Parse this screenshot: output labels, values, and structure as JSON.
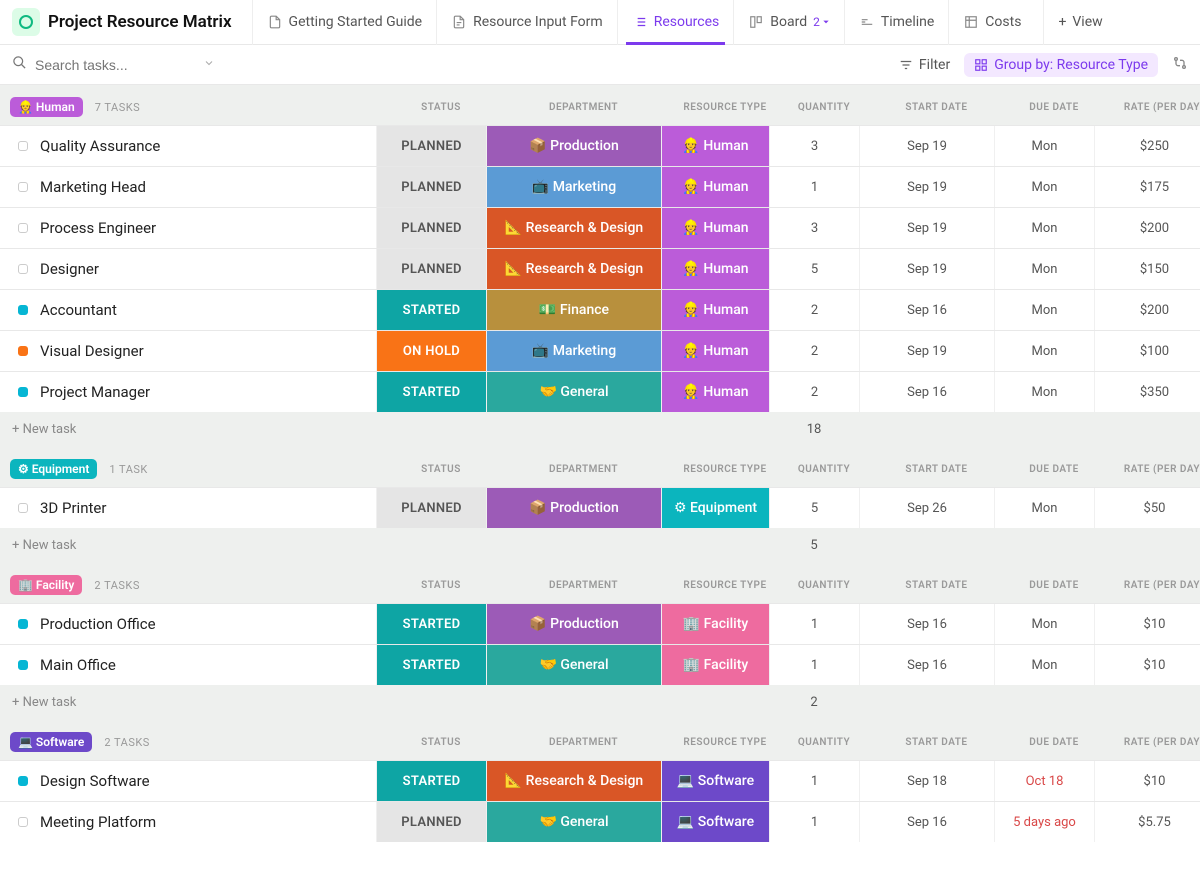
{
  "header": {
    "title": "Project Resource Matrix",
    "tabs": [
      {
        "label": "Getting Started Guide",
        "icon": "doc"
      },
      {
        "label": "Resource Input Form",
        "icon": "form"
      },
      {
        "label": "Resources",
        "icon": "list",
        "active": true
      },
      {
        "label": "Board",
        "icon": "board",
        "badge": "2"
      },
      {
        "label": "Timeline",
        "icon": "timeline"
      },
      {
        "label": "Costs",
        "icon": "table"
      }
    ],
    "add_view": "View"
  },
  "toolbar": {
    "search_placeholder": "Search tasks...",
    "filter_label": "Filter",
    "group_label": "Group by: Resource Type"
  },
  "columns": [
    "STATUS",
    "DEPARTMENT",
    "RESOURCE TYPE",
    "QUANTITY",
    "START DATE",
    "DUE DATE",
    "RATE (PER DAY)"
  ],
  "groups": [
    {
      "label": "👷 Human",
      "pill_color": "#bb5cd9",
      "count_text": "7 TASKS",
      "rows": [
        {
          "bullet": "",
          "name": "Quality Assurance",
          "status": "PLANNED",
          "status_cls": "st-planned",
          "dept": "📦 Production",
          "dept_cls": "dept-prod",
          "rtype": "👷 Human",
          "rtype_cls": "rt-human",
          "qty": "3",
          "start": "Sep 19",
          "due": "Mon",
          "rate": "$250"
        },
        {
          "bullet": "",
          "name": "Marketing Head",
          "status": "PLANNED",
          "status_cls": "st-planned",
          "dept": "📺 Marketing",
          "dept_cls": "dept-mkt",
          "rtype": "👷 Human",
          "rtype_cls": "rt-human",
          "qty": "1",
          "start": "Sep 19",
          "due": "Mon",
          "rate": "$175"
        },
        {
          "bullet": "",
          "name": "Process Engineer",
          "status": "PLANNED",
          "status_cls": "st-planned",
          "dept": "📐 Research & Design",
          "dept_cls": "dept-rnd",
          "rtype": "👷 Human",
          "rtype_cls": "rt-human",
          "qty": "3",
          "start": "Sep 19",
          "due": "Mon",
          "rate": "$200"
        },
        {
          "bullet": "",
          "name": "Designer",
          "status": "PLANNED",
          "status_cls": "st-planned",
          "dept": "📐 Research & Design",
          "dept_cls": "dept-rnd",
          "rtype": "👷 Human",
          "rtype_cls": "rt-human",
          "qty": "5",
          "start": "Sep 19",
          "due": "Mon",
          "rate": "$150"
        },
        {
          "bullet": "teal",
          "name": "Accountant",
          "status": "STARTED",
          "status_cls": "st-started",
          "dept": "💵 Finance",
          "dept_cls": "dept-fin",
          "rtype": "👷 Human",
          "rtype_cls": "rt-human",
          "qty": "2",
          "start": "Sep 16",
          "due": "Mon",
          "rate": "$200"
        },
        {
          "bullet": "orange",
          "name": "Visual Designer",
          "status": "ON HOLD",
          "status_cls": "st-hold",
          "dept": "📺 Marketing",
          "dept_cls": "dept-mkt",
          "rtype": "👷 Human",
          "rtype_cls": "rt-human",
          "qty": "2",
          "start": "Sep 19",
          "due": "Mon",
          "rate": "$100"
        },
        {
          "bullet": "teal",
          "name": "Project Manager",
          "status": "STARTED",
          "status_cls": "st-started",
          "dept": "🤝 General",
          "dept_cls": "dept-gen",
          "rtype": "👷 Human",
          "rtype_cls": "rt-human",
          "qty": "2",
          "start": "Sep 16",
          "due": "Mon",
          "rate": "$350"
        }
      ],
      "total_qty": "18"
    },
    {
      "label": "⚙ Equipment",
      "pill_color": "#0bb5be",
      "count_text": "1 TASK",
      "rows": [
        {
          "bullet": "",
          "name": "3D Printer",
          "status": "PLANNED",
          "status_cls": "st-planned",
          "dept": "📦 Production",
          "dept_cls": "dept-prod",
          "rtype": "⚙ Equipment",
          "rtype_cls": "rt-equip",
          "qty": "5",
          "start": "Sep 26",
          "due": "Mon",
          "rate": "$50"
        }
      ],
      "total_qty": "5"
    },
    {
      "label": "🏢 Facility",
      "pill_color": "#ee6b9f",
      "count_text": "2 TASKS",
      "rows": [
        {
          "bullet": "teal",
          "name": "Production Office",
          "status": "STARTED",
          "status_cls": "st-started",
          "dept": "📦 Production",
          "dept_cls": "dept-prod",
          "rtype": "🏢 Facility",
          "rtype_cls": "rt-fac",
          "qty": "1",
          "start": "Sep 16",
          "due": "Mon",
          "rate": "$10"
        },
        {
          "bullet": "teal",
          "name": "Main Office",
          "status": "STARTED",
          "status_cls": "st-started",
          "dept": "🤝 General",
          "dept_cls": "dept-gen",
          "rtype": "🏢 Facility",
          "rtype_cls": "rt-fac",
          "qty": "1",
          "start": "Sep 16",
          "due": "Mon",
          "rate": "$10"
        }
      ],
      "total_qty": "2"
    },
    {
      "label": "💻 Software",
      "pill_color": "#6d49c9",
      "count_text": "2 TASKS",
      "rows": [
        {
          "bullet": "teal",
          "name": "Design Software",
          "status": "STARTED",
          "status_cls": "st-started",
          "dept": "📐 Research & Design",
          "dept_cls": "dept-rnd",
          "rtype": "💻 Software",
          "rtype_cls": "rt-soft",
          "qty": "1",
          "start": "Sep 18",
          "due": "Oct 18",
          "due_over": true,
          "rate": "$10"
        },
        {
          "bullet": "",
          "name": "Meeting Platform",
          "status": "PLANNED",
          "status_cls": "st-planned",
          "dept": "🤝 General",
          "dept_cls": "dept-gen",
          "rtype": "💻 Software",
          "rtype_cls": "rt-soft",
          "qty": "1",
          "start": "Sep 16",
          "due": "5 days ago",
          "due_over": true,
          "rate": "$5.75"
        }
      ],
      "total_qty": ""
    }
  ],
  "new_task_label": "+ New task"
}
